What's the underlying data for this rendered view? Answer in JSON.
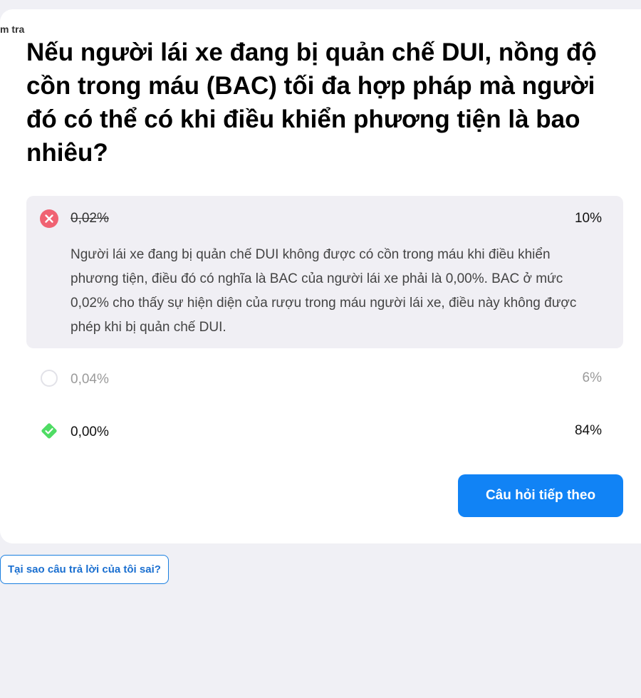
{
  "breadcrumb": "m tra",
  "question": "Nếu người lái xe đang bị quản chế DUI, nồng độ cồn trong máu (BAC) tối đa hợp pháp mà người đó có thể có khi điều khiển phương tiện là bao nhiêu?",
  "answers": [
    {
      "label": "0,02%",
      "percent": "10%",
      "status": "incorrect-selected",
      "icon": "x-circle-icon",
      "explanation": "Người lái xe đang bị quản chế DUI không được có cồn trong máu khi điều khiển phương tiện, điều đó có nghĩa là BAC của người lái xe phải là 0,00%. BAC ở mức 0,02% cho thấy sự hiện diện của rượu trong máu người lái xe, điều này không được phép khi bị quản chế DUI."
    },
    {
      "label": "0,04%",
      "percent": "6%",
      "status": "unselected",
      "icon": "empty-circle-icon"
    },
    {
      "label": "0,00%",
      "percent": "84%",
      "status": "correct",
      "icon": "check-diamond-icon"
    }
  ],
  "next_button": "Câu hỏi tiếp theo",
  "why_wrong_link": "Tại sao câu trả lời của tôi sai?",
  "colors": {
    "accent": "#1183f5",
    "incorrect": "#f06272",
    "correct": "#4fdc64",
    "background": "#f0f0f5"
  }
}
